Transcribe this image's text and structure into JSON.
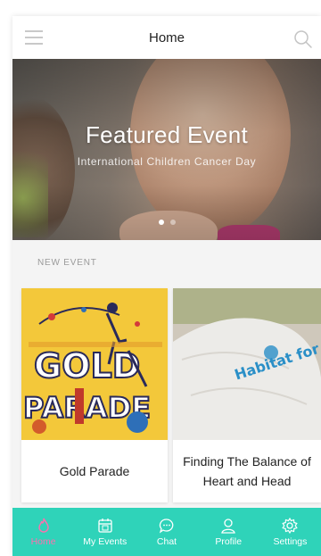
{
  "header": {
    "title": "Home",
    "menu_icon": "hamburger-menu-icon",
    "search_icon": "search-icon"
  },
  "featured": {
    "title": "Featured Event",
    "subtitle": "International Children Cancer Day",
    "slides": 2,
    "active_slide": 1
  },
  "section": {
    "label": "NEW EVENT"
  },
  "events": [
    {
      "title": "Gold Parade",
      "poster_text_line1": "GOLD",
      "poster_text_line2": "PARADE"
    },
    {
      "title": "Finding The Balance of Heart and Head",
      "image_text": "Habitat for Humanity Indonesia"
    }
  ],
  "nav": {
    "items": [
      {
        "label": "Home",
        "icon": "flame-icon",
        "active": true
      },
      {
        "label": "My Events",
        "icon": "calendar-icon",
        "active": false
      },
      {
        "label": "Chat",
        "icon": "chat-bubble-icon",
        "active": false
      },
      {
        "label": "Profile",
        "icon": "person-icon",
        "active": false
      },
      {
        "label": "Settings",
        "icon": "gear-icon",
        "active": false
      }
    ]
  },
  "colors": {
    "nav_background": "#2fd3b9",
    "nav_active": "#ff6fae",
    "poster_yellow": "#f3c83a"
  }
}
